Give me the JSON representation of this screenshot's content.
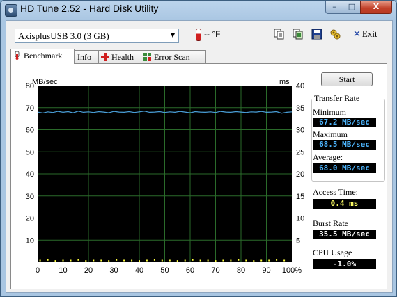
{
  "window": {
    "title": "HD Tune 2.52 - Hard Disk Utility",
    "caption_buttons": {
      "minimize": "–",
      "maximize": "□",
      "close": "X"
    }
  },
  "toolbar": {
    "drive": "AxisplusUSB 3.0 (3 GB)",
    "temperature": "-- °F",
    "icons": [
      "copy-text-icon",
      "copy-screenshot-icon",
      "save-icon",
      "options-icon"
    ],
    "exit_label": "Exit"
  },
  "tabs": [
    {
      "label": "Benchmark",
      "icon": "benchmark-icon",
      "active": true
    },
    {
      "label": "Info",
      "icon": "info-icon",
      "active": false
    },
    {
      "label": "Health",
      "icon": "health-icon",
      "active": false
    },
    {
      "label": "Error Scan",
      "icon": "error-scan-icon",
      "active": false
    }
  ],
  "benchmark": {
    "start_label": "Start",
    "transfer_rate_title": "Transfer Rate",
    "minimum_label": "Minimum",
    "minimum_value": "67.2 MB/sec",
    "maximum_label": "Maximum",
    "maximum_value": "68.5 MB/sec",
    "average_label": "Average:",
    "average_value": "68.0 MB/sec",
    "access_time_label": "Access Time:",
    "access_time_value": "0.4 ms",
    "burst_rate_label": "Burst Rate",
    "burst_rate_value": "35.5 MB/sec",
    "cpu_usage_label": "CPU Usage",
    "cpu_usage_value": "-1.0%"
  },
  "colors": {
    "plot_background": "#000000",
    "grid": "#2a6a2a",
    "transfer_line": "#4a9fd8",
    "access_points": "#ffff40",
    "blue_value": "#4db6ff",
    "yellow_value": "#ffff66"
  },
  "chart_data": {
    "type": "line",
    "left_axis_label": "MB/sec",
    "right_axis_label": "ms",
    "ylim_left": [
      0,
      80
    ],
    "ylim_right": [
      0,
      40
    ],
    "xlim": [
      0,
      100
    ],
    "yticks_left": [
      10,
      20,
      30,
      40,
      50,
      60,
      70,
      80
    ],
    "yticks_right": [
      5,
      10,
      15,
      20,
      25,
      30,
      35,
      40
    ],
    "xticks": [
      "0",
      "10",
      "20",
      "30",
      "40",
      "50",
      "60",
      "70",
      "80",
      "90",
      "100%"
    ],
    "grid": true,
    "series": [
      {
        "axis": "left",
        "x": [
          0,
          2,
          4,
          6,
          8,
          10,
          12,
          14,
          16,
          18,
          20,
          22,
          24,
          26,
          28,
          30,
          32,
          34,
          36,
          38,
          40,
          42,
          44,
          46,
          48,
          50,
          52,
          54,
          56,
          58,
          60,
          62,
          64,
          66,
          68,
          70,
          72,
          74,
          76,
          78,
          80,
          82,
          84,
          86,
          88,
          90,
          92,
          94,
          96,
          98,
          100
        ],
        "values": [
          68.0,
          67.6,
          68.1,
          67.8,
          68.3,
          67.9,
          68.2,
          67.7,
          68.4,
          67.9,
          68.1,
          67.8,
          68.2,
          68.0,
          67.7,
          68.3,
          68.0,
          67.9,
          68.2,
          67.8,
          68.1,
          68.4,
          67.9,
          68.0,
          68.2,
          67.8,
          68.1,
          67.9,
          68.3,
          68.0,
          67.7,
          68.2,
          68.0,
          67.9,
          68.1,
          67.8,
          68.3,
          68.0,
          67.9,
          68.2,
          68.0,
          67.8,
          68.1,
          68.0,
          68.3,
          67.9,
          68.0,
          68.2,
          67.5,
          67.9,
          68.1
        ]
      },
      {
        "axis": "right",
        "type": "scatter",
        "x": [
          1,
          4,
          7,
          10,
          13,
          16,
          19,
          22,
          25,
          28,
          31,
          34,
          37,
          40,
          43,
          46,
          49,
          52,
          55,
          58,
          61,
          64,
          67,
          70,
          73,
          76,
          79,
          82,
          85,
          88,
          91,
          94,
          97
        ],
        "values": [
          0.4,
          0.5,
          0.3,
          0.4,
          0.4,
          0.5,
          0.3,
          0.4,
          0.4,
          0.3,
          0.5,
          0.4,
          0.4,
          0.3,
          0.4,
          0.5,
          0.4,
          0.4,
          0.3,
          0.4,
          0.5,
          0.4,
          0.4,
          0.3,
          0.4,
          0.4,
          0.5,
          0.4,
          0.3,
          0.4,
          0.4,
          0.5,
          0.4
        ]
      }
    ]
  }
}
